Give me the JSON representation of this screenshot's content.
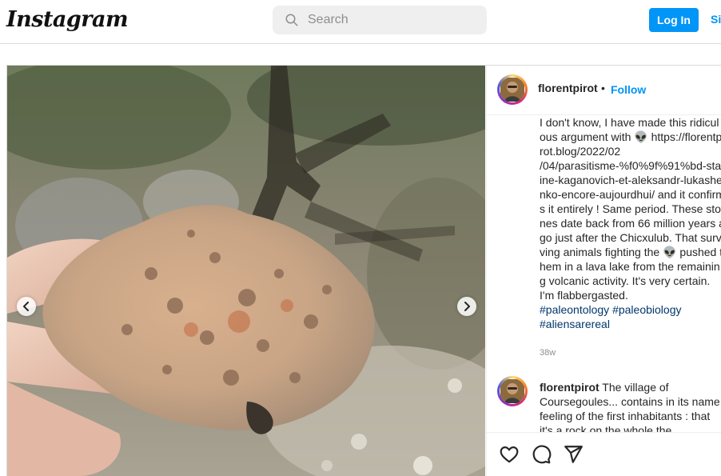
{
  "app": {
    "logo_text": "Instagram"
  },
  "header": {
    "search_placeholder": "Search",
    "login_label": "Log In",
    "signup_label": "Sign Up"
  },
  "post": {
    "author": {
      "username": "florentpirot",
      "separator": "•",
      "follow_label": "Follow"
    },
    "caption": {
      "text": "I don't know, I have made this ridiculous argument with 👽 https://florentpirot.blog/2022/02\n/04/parasitisme-%f0%9f%91%bd-staline-kaganovich-et-aleksandr-lukashenko-encore-aujourdhui/ and it confirms it entirely ! Same period. These stones date back from 66 million years ago just after the Chicxulub. That surviving animals fighting the 👽 pushed them in a lava lake from the remaining volcanic activity. It's very certain. I'm flabbergasted.",
      "hashtags": "#paleontology #paleobiology #aliensarereal",
      "timestamp": "38w"
    },
    "comments": [
      {
        "username": "florentpirot",
        "text": " The village of Coursegoules... contains in its name feeling of the first inhabitants : that it's a rock on the whole the ..."
      }
    ],
    "actions": {
      "like_icon": "heart-icon",
      "comment_icon": "comment-icon",
      "share_icon": "share-icon"
    },
    "carousel": {
      "prev_icon": "chevron-left-icon",
      "next_icon": "chevron-right-icon"
    }
  },
  "colors": {
    "accent": "#0095f6",
    "hashtag": "#00376b",
    "muted": "#8e8e8e",
    "border": "#dbdbdb",
    "search_bg": "#efefef"
  }
}
